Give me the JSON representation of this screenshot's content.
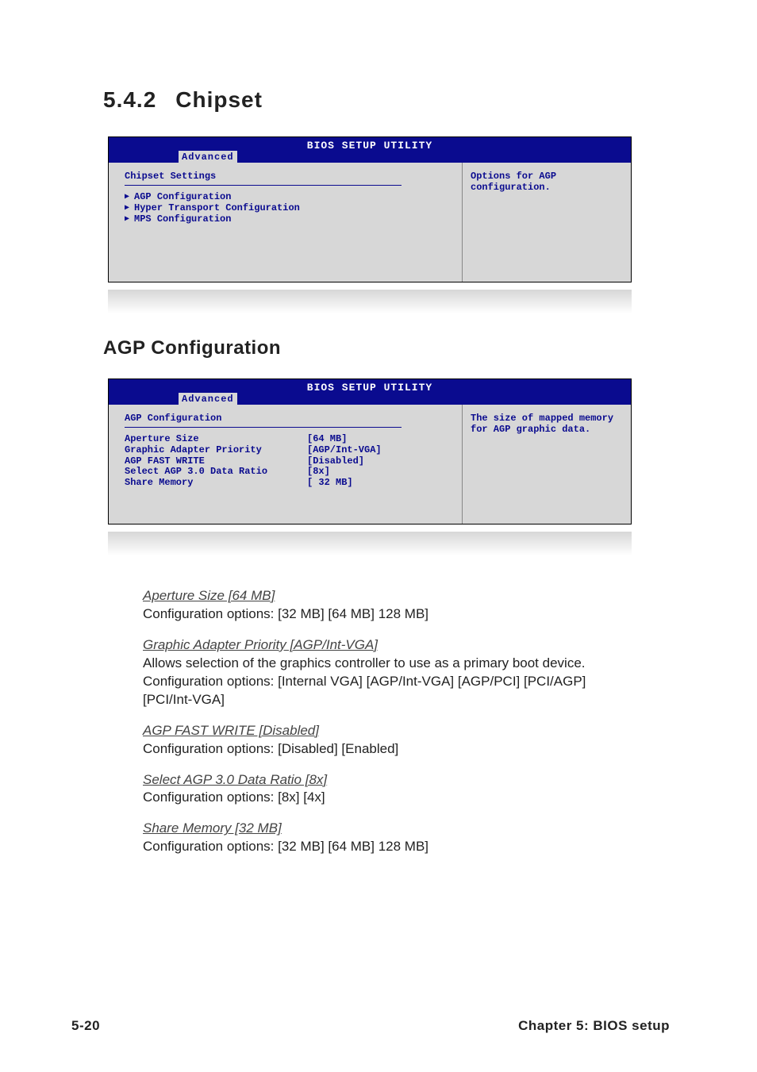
{
  "section": {
    "number": "5.4.2",
    "title": "Chipset"
  },
  "bios1": {
    "utility_title": "BIOS SETUP UTILITY",
    "tab": "Advanced",
    "panel_title": "Chipset Settings",
    "submenus": [
      "AGP Configuration",
      "Hyper Transport Configuration",
      "MPS Configuration"
    ],
    "help": "Options for AGP configuration."
  },
  "subsection": "AGP Configuration",
  "bios2": {
    "utility_title": "BIOS SETUP UTILITY",
    "tab": "Advanced",
    "panel_title": "AGP Configuration",
    "rows": [
      {
        "label": "Aperture Size",
        "value": "[64 MB]"
      },
      {
        "label": "Graphic Adapter Priority",
        "value": "[AGP/Int-VGA]"
      },
      {
        "label": "AGP FAST WRITE",
        "value": "[Disabled]"
      },
      {
        "label": "Select AGP 3.0 Data Ratio",
        "value": "[8x]"
      },
      {
        "label": "Share Memory",
        "value": "[ 32 MB]"
      }
    ],
    "help": "The size of mapped memory for AGP graphic data."
  },
  "descriptions": [
    {
      "setting": "Aperture Size [64 MB]",
      "text": "Configuration options: [32 MB] [64 MB] 128 MB]"
    },
    {
      "setting": "Graphic Adapter Priority [AGP/Int-VGA]",
      "text": "Allows selection of the graphics controller to use as a primary boot device. Configuration options: [Internal VGA] [AGP/Int-VGA] [AGP/PCI] [PCI/AGP] [PCI/Int-VGA]"
    },
    {
      "setting": "AGP FAST WRITE [Disabled]",
      "text": "Configuration options: [Disabled] [Enabled]"
    },
    {
      "setting": "Select AGP 3.0 Data Ratio [8x]",
      "text": "Configuration options: [8x] [4x]"
    },
    {
      "setting": "Share Memory [32 MB]",
      "text": "Configuration options: [32 MB] [64 MB] 128 MB]"
    }
  ],
  "footer": {
    "page": "5-20",
    "chapter": "Chapter 5: BIOS setup"
  }
}
